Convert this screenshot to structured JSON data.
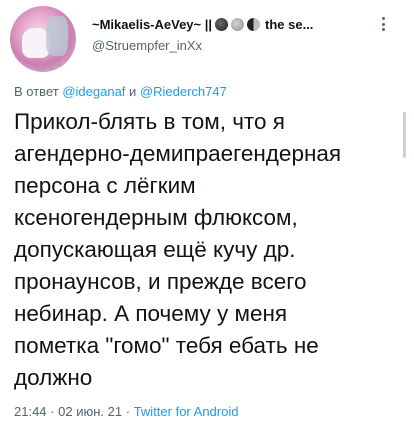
{
  "header": {
    "display_name": "~Mikaelis-AeVey~ ||",
    "name_suffix": "the se...",
    "handle": "@Struempfer_inXx"
  },
  "reply": {
    "prefix": "В ответ",
    "mention_1": "@ideganaf",
    "conjunction": "и",
    "mention_2": "@Riederch747"
  },
  "tweet": {
    "lines": [
      "Прикол-блять в том, что я",
      "агендерно-демипраегендерная",
      "персона с лёгким",
      "ксеногендерным флюксом,",
      "допускающая ещё кучу др.",
      "пронаунсов, и прежде всего",
      "небинар. А почему у меня",
      "пометка \"гомо\" тебя ебать не",
      "должно"
    ]
  },
  "meta": {
    "time": "21:44",
    "separator_1": "·",
    "date": "02 июн. 21",
    "separator_2": "·",
    "source": "Twitter for Android"
  },
  "icons": {
    "avatar": "avatar-image",
    "more": "more-vertical-icon",
    "emojis": [
      "black-circle-emoji",
      "grey-circle-emoji",
      "half-moon-emoji"
    ]
  },
  "colors": {
    "text": "#0f1419",
    "secondary": "#536471",
    "link": "#1d9bf0"
  }
}
